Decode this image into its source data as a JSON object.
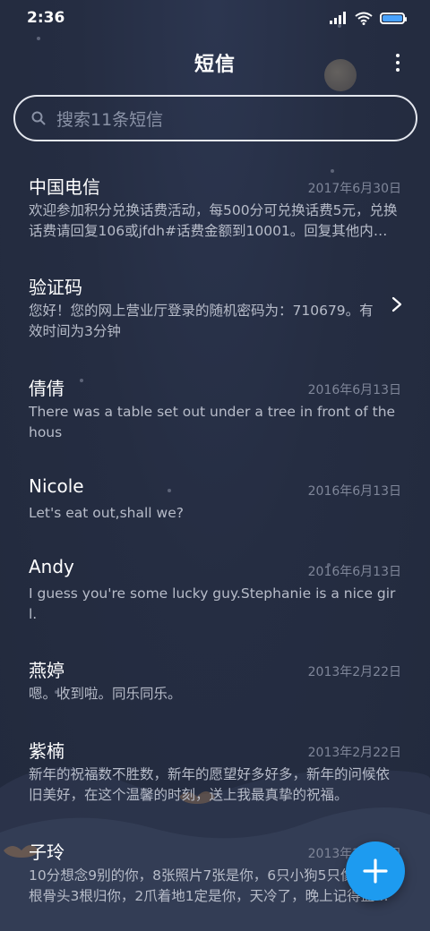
{
  "status": {
    "time": "2:36",
    "battery_level": 1.0
  },
  "header": {
    "title": "短信"
  },
  "search": {
    "placeholder": "搜索11条短信"
  },
  "messages": [
    {
      "sender": "中国电信",
      "date": "2017年6月30日",
      "preview": "欢迎参加积分兑换话费活动，每500分可兑换话费5元，兑换话费请回复106或jfdh#话费金额到10001。回复其他内容无效。"
    },
    {
      "sender": "验证码",
      "date": "",
      "preview": "您好！您的网上营业厅登录的随机密码为：710679。有效时间为3分钟"
    },
    {
      "sender": "倩倩",
      "date": "2016年6月13日",
      "preview": "There was a table set out under a tree in front of the hous"
    },
    {
      "sender": "Nicole",
      "date": "2016年6月13日",
      "preview": "Let's eat out,shall we?"
    },
    {
      "sender": "Andy",
      "date": "2016年6月13日",
      "preview": "I guess you're some lucky guy.Stephanie is a nice girl."
    },
    {
      "sender": "燕婷",
      "date": "2013年2月22日",
      "preview": "嗯。收到啦。同乐同乐。"
    },
    {
      "sender": "紫楠",
      "date": "2013年2月22日",
      "preview": "新年的祝福数不胜数，新年的愿望好多好多，新年的问候依旧美好，在这个温馨的时刻，送上我最真挚的祝福。"
    },
    {
      "sender": "子玲",
      "date": "2013年2月22日",
      "preview": "10分想念9别的你，8张照片7张是你，6只小狗5只像你，4根骨头3根归你，2爪着地1定是你，天冷了，晚上记得盖被子。"
    }
  ],
  "colors": {
    "background": "#252d42",
    "accent": "#1d9bf0",
    "sender": "#ffffff",
    "preview": "#b7bcc9",
    "date": "#7f8699"
  },
  "icons": {
    "signal": "signal-icon",
    "wifi": "wifi-icon",
    "battery": "battery-icon",
    "more": "more-vertical-icon",
    "search": "search-icon",
    "chevron": "chevron-right-icon",
    "compose": "plus-icon"
  }
}
